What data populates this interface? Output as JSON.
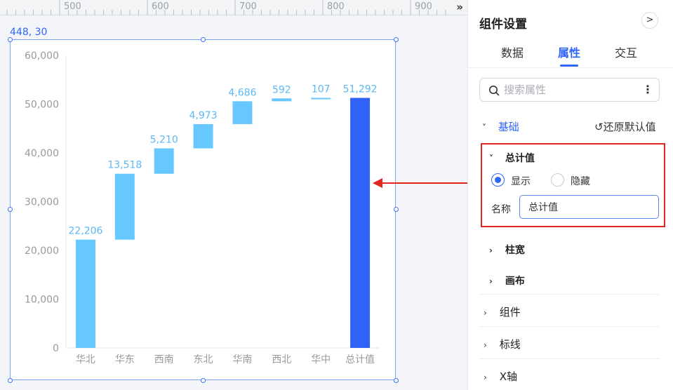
{
  "ruler": {
    "labels": [
      "500",
      "600",
      "700",
      "800",
      "900"
    ],
    "collapse_icon": "double-chevron-right-icon"
  },
  "selection": {
    "coordinates": "448, 30"
  },
  "chart_data": {
    "type": "bar",
    "subtype": "waterfall",
    "categories": [
      "华北",
      "华东",
      "西南",
      "东北",
      "华南",
      "西北",
      "华中",
      "总计值"
    ],
    "values": [
      22206,
      13518,
      5210,
      4973,
      4686,
      592,
      107,
      51292
    ],
    "data_labels": [
      "22,206",
      "13,518",
      "5,210",
      "4,973",
      "4,686",
      "592",
      "107",
      "51,292"
    ],
    "ylim": [
      0,
      60000
    ],
    "yticks": [
      0,
      10000,
      20000,
      30000,
      40000,
      50000,
      60000
    ],
    "ytick_labels": [
      "0",
      "10,000",
      "20,000",
      "30,000",
      "40,000",
      "50,000",
      "60,000"
    ],
    "colors": {
      "increment": "#66c8ff",
      "total": "#2f62f5",
      "label": "#5bb8f5",
      "axis_text": "#999999"
    },
    "grid": false
  },
  "panel": {
    "title": "组件设置",
    "expand_icon": "chevron-right-icon",
    "tabs": [
      {
        "label": "数据",
        "active": false
      },
      {
        "label": "属性",
        "active": true
      },
      {
        "label": "交互",
        "active": false
      }
    ],
    "search": {
      "placeholder": "搜索属性",
      "value": ""
    },
    "basic": {
      "label": "基础",
      "reset_label": "还原默认值",
      "total": {
        "label": "总计值",
        "show_label": "显示",
        "hide_label": "隐藏",
        "selected": "显示",
        "name_label": "名称",
        "name_value": "总计值"
      },
      "sub_sections": [
        "柱宽",
        "画布"
      ]
    },
    "sections": [
      "组件",
      "标线",
      "X轴"
    ]
  },
  "accent_color": "#2f66f6",
  "highlight_color": "#e0261f"
}
